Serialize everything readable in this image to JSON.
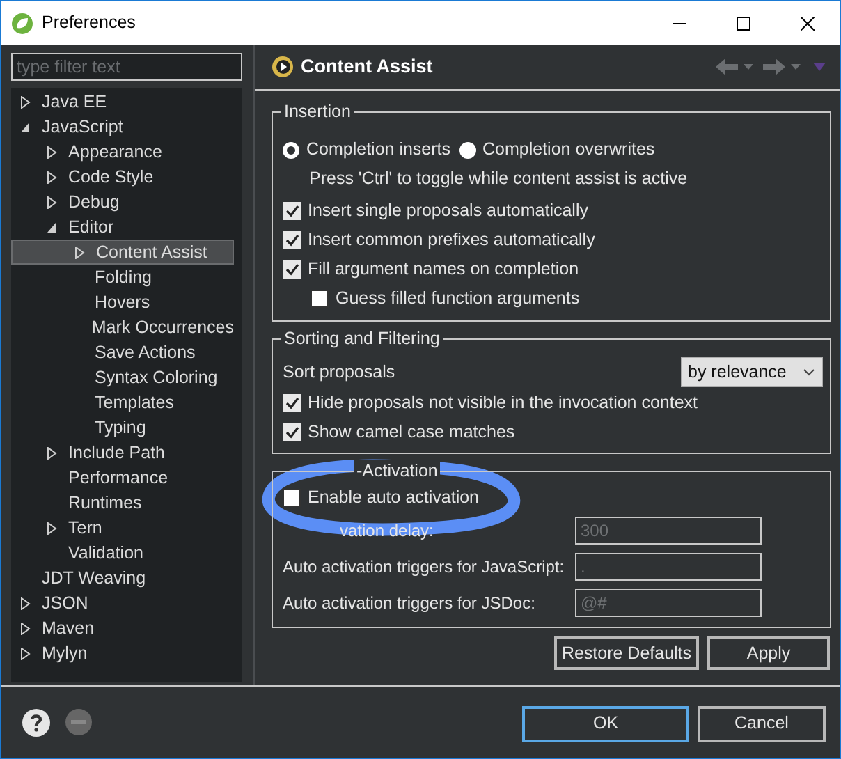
{
  "window": {
    "title": "Preferences"
  },
  "filter": {
    "placeholder": "type filter text"
  },
  "tree": [
    {
      "label": "Java EE",
      "kind": "node",
      "expanded": false,
      "selected": false
    },
    {
      "label": "JavaScript",
      "kind": "node",
      "expanded": true,
      "selected": false,
      "children": [
        {
          "label": "Appearance",
          "kind": "node",
          "expanded": false,
          "selected": false
        },
        {
          "label": "Code Style",
          "kind": "node",
          "expanded": false,
          "selected": false
        },
        {
          "label": "Debug",
          "kind": "node",
          "expanded": false,
          "selected": false
        },
        {
          "label": "Editor",
          "kind": "node",
          "expanded": true,
          "selected": false,
          "children": [
            {
              "label": "Content Assist",
              "kind": "node",
              "expanded": false,
              "selected": true
            },
            {
              "label": "Folding",
              "kind": "leaf",
              "selected": false
            },
            {
              "label": "Hovers",
              "kind": "leaf",
              "selected": false
            },
            {
              "label": "Mark Occurrences",
              "kind": "leaf",
              "selected": false
            },
            {
              "label": "Save Actions",
              "kind": "leaf",
              "selected": false
            },
            {
              "label": "Syntax Coloring",
              "kind": "leaf",
              "selected": false
            },
            {
              "label": "Templates",
              "kind": "leaf",
              "selected": false
            },
            {
              "label": "Typing",
              "kind": "leaf",
              "selected": false
            }
          ]
        },
        {
          "label": "Include Path",
          "kind": "node",
          "expanded": false,
          "selected": false
        },
        {
          "label": "Performance",
          "kind": "leaf",
          "selected": false
        },
        {
          "label": "Runtimes",
          "kind": "leaf",
          "selected": false
        },
        {
          "label": "Tern",
          "kind": "node",
          "expanded": false,
          "selected": false
        },
        {
          "label": "Validation",
          "kind": "leaf",
          "selected": false
        }
      ]
    },
    {
      "label": "JDT Weaving",
      "kind": "leaf",
      "selected": false
    },
    {
      "label": "JSON",
      "kind": "node",
      "expanded": false,
      "selected": false
    },
    {
      "label": "Maven",
      "kind": "node",
      "expanded": false,
      "selected": false
    },
    {
      "label": "Mylyn",
      "kind": "node",
      "expanded": false,
      "selected": false
    }
  ],
  "page": {
    "title": "Content Assist",
    "insertion": {
      "title": "Insertion",
      "radios": [
        {
          "label": "Completion inserts",
          "selected": true
        },
        {
          "label": "Completion overwrites",
          "selected": false
        }
      ],
      "hint": "Press 'Ctrl' to toggle while content assist is active",
      "checkboxes": [
        {
          "label": "Insert single proposals automatically",
          "checked": true
        },
        {
          "label": "Insert common prefixes automatically",
          "checked": true
        },
        {
          "label": "Fill argument names on completion",
          "checked": true,
          "children": [
            {
              "label": "Guess filled function arguments",
              "checked": false
            }
          ]
        }
      ]
    },
    "sorting": {
      "title": "Sorting and Filtering",
      "sort_label": "Sort proposals",
      "sort_value": "by relevance",
      "checkboxes": [
        {
          "label": "Hide proposals not visible in the invocation context",
          "checked": true
        },
        {
          "label": "Show camel case matches",
          "checked": true
        }
      ]
    },
    "auto": {
      "title": "-Activation",
      "checkbox": {
        "label": "Enable auto activation",
        "checked": false
      },
      "fields": [
        {
          "label": "vation delay:",
          "value": "300",
          "disabled": true
        },
        {
          "label": "Auto activation triggers for JavaScript:",
          "value": ".",
          "disabled": true
        },
        {
          "label": "Auto activation triggers for JSDoc:",
          "value": "@#",
          "disabled": true
        }
      ]
    },
    "buttons": [
      {
        "label": "Restore Defaults"
      },
      {
        "label": "Apply"
      }
    ]
  },
  "dialog_buttons": [
    {
      "label": "OK",
      "default": true
    },
    {
      "label": "Cancel",
      "default": false
    }
  ]
}
